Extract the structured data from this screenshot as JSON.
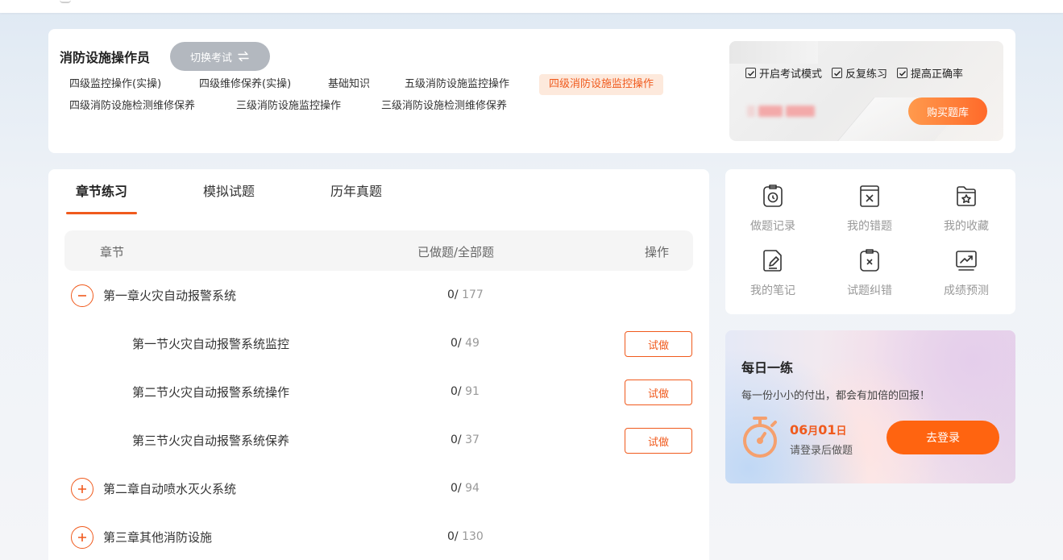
{
  "header": {
    "exam_title": "消防设施操作员",
    "switch_label": "切换考试",
    "subjects": [
      "四级监控操作(实操)",
      "四级维修保养(实操)",
      "基础知识",
      "五级消防设施监控操作",
      "四级消防设施监控操作",
      "四级消防设施检测维修保养",
      "三级消防设施监控操作",
      "三级消防设施检测维修保养"
    ],
    "active_subject": "四级消防设施监控操作"
  },
  "promo": {
    "options": [
      "开启考试模式",
      "反复练习",
      "提高正确率"
    ],
    "buy_label": "购买题库"
  },
  "tabs": [
    "章节练习",
    "模拟试题",
    "历年真题"
  ],
  "active_tab": "章节练习",
  "table": {
    "col_chapter": "章节",
    "col_progress": "已做题/全部题",
    "col_action": "操作",
    "try_label": "试做",
    "rows": [
      {
        "name": "第一章火灾自动报警系统",
        "done": "0/",
        "total": "177",
        "level": "chapter",
        "expanded": true
      },
      {
        "name": "第一节火灾自动报警系统监控",
        "done": "0/",
        "total": "49",
        "level": "section"
      },
      {
        "name": "第二节火灾自动报警系统操作",
        "done": "0/",
        "total": "91",
        "level": "section"
      },
      {
        "name": "第三节火灾自动报警系统保养",
        "done": "0/",
        "total": "37",
        "level": "section"
      },
      {
        "name": "第二章自动喷水灭火系统",
        "done": "0/",
        "total": "94",
        "level": "chapter",
        "expanded": false
      },
      {
        "name": "第三章其他消防设施",
        "done": "0/",
        "total": "130",
        "level": "chapter",
        "expanded": false
      }
    ]
  },
  "tools": [
    {
      "label": "做题记录",
      "icon": "clipboard-clock-icon"
    },
    {
      "label": "我的错题",
      "icon": "book-x-icon"
    },
    {
      "label": "我的收藏",
      "icon": "folder-star-icon"
    },
    {
      "label": "我的笔记",
      "icon": "document-pen-icon"
    },
    {
      "label": "试题纠错",
      "icon": "clipboard-x-icon"
    },
    {
      "label": "成绩预测",
      "icon": "trend-chart-icon"
    }
  ],
  "daily": {
    "title": "每日一练",
    "subtitle": "每一份小小的付出，都会有加倍的回报！",
    "date_month": "06",
    "date_month_unit": "月",
    "date_day": "01",
    "date_day_unit": "日",
    "hint": "请登录后做题",
    "login_label": "去登录"
  },
  "colors": {
    "accent": "#f05a1d",
    "login_button": "#ff6410",
    "active_subject_bg": "#fde9dc"
  }
}
